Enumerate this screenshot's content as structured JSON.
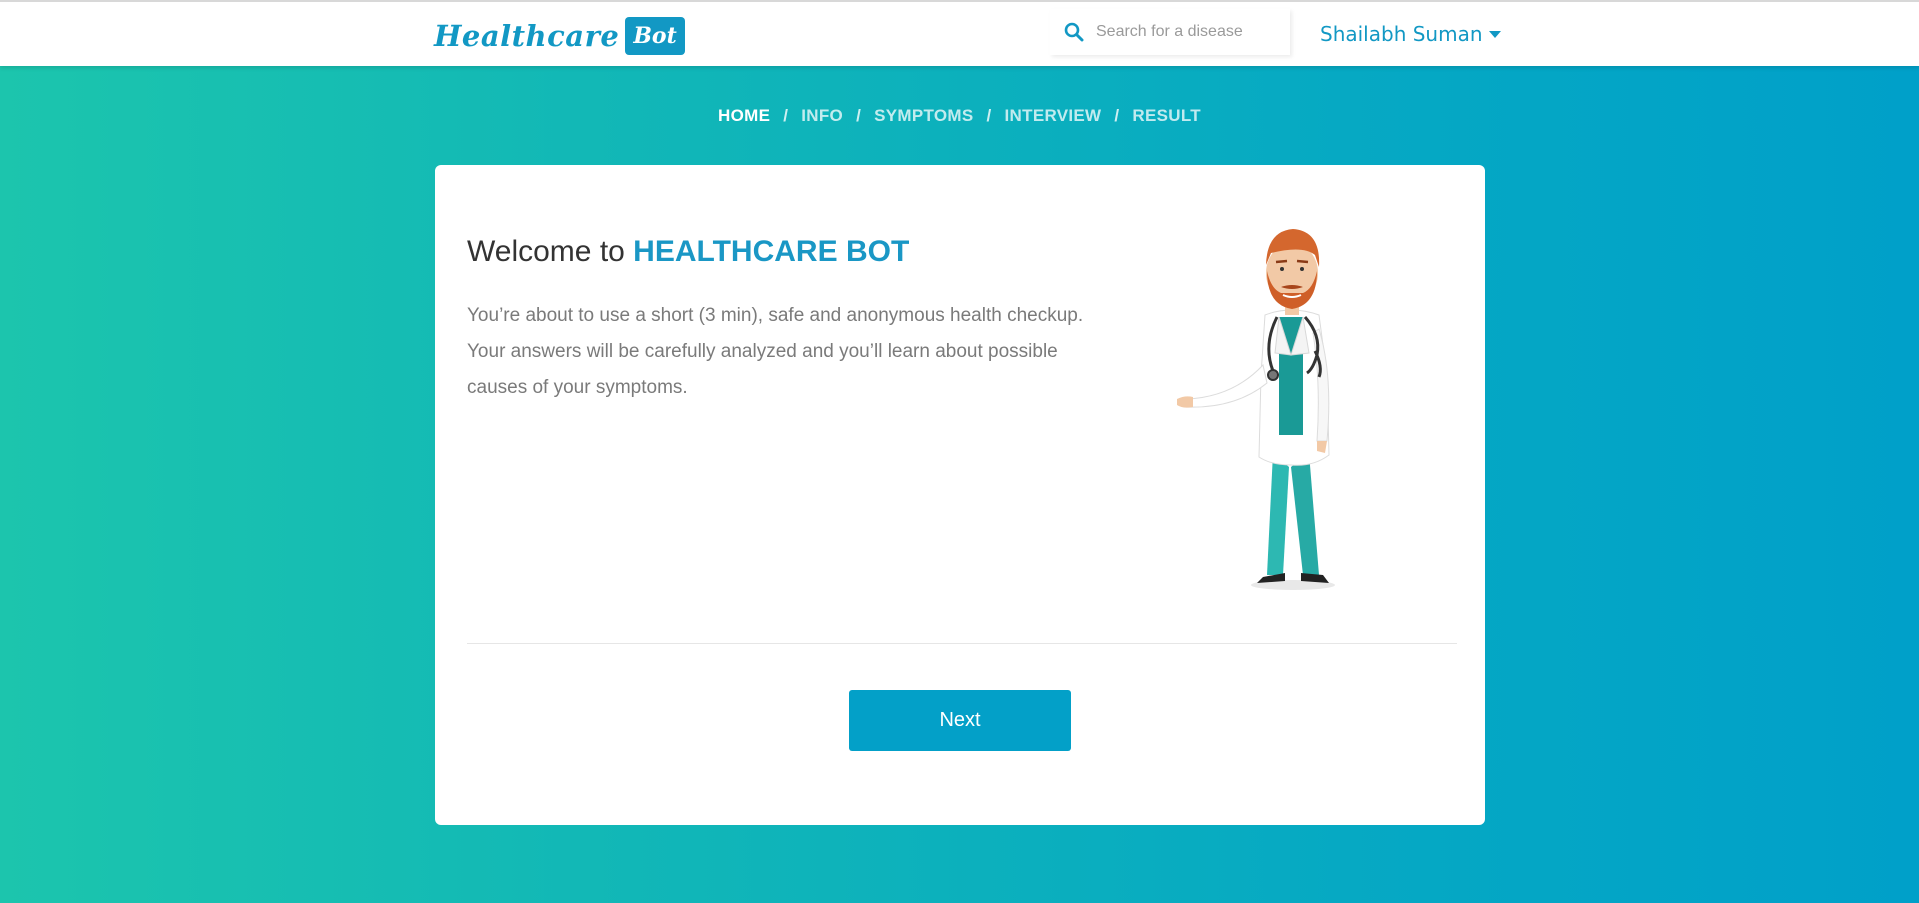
{
  "header": {
    "logo_text": "Healthcare",
    "logo_badge": "Bot",
    "search_placeholder": "Search for a disease",
    "user_name": "Shailabh Suman"
  },
  "breadcrumb": {
    "items": [
      "HOME",
      "INFO",
      "SYMPTOMS",
      "INTERVIEW",
      "RESULT"
    ],
    "separator": "/",
    "active_index": 0
  },
  "main": {
    "welcome_prefix": "Welcome to ",
    "welcome_brand": "HEALTHCARE BOT",
    "description": "You’re about to use a short (3 min), safe and anonymous health checkup. Your answers will be carefully analyzed and you’ll learn about possible causes of your symptoms.",
    "next_label": "Next"
  },
  "icons": {
    "search": "search-icon",
    "user_menu": "caret-down-icon",
    "illustration": "doctor-illustration"
  },
  "colors": {
    "brand": "#1298c4",
    "button": "#03a0c8",
    "gradient_start": "#1cc5ad",
    "gradient_end": "#00a0c9"
  }
}
